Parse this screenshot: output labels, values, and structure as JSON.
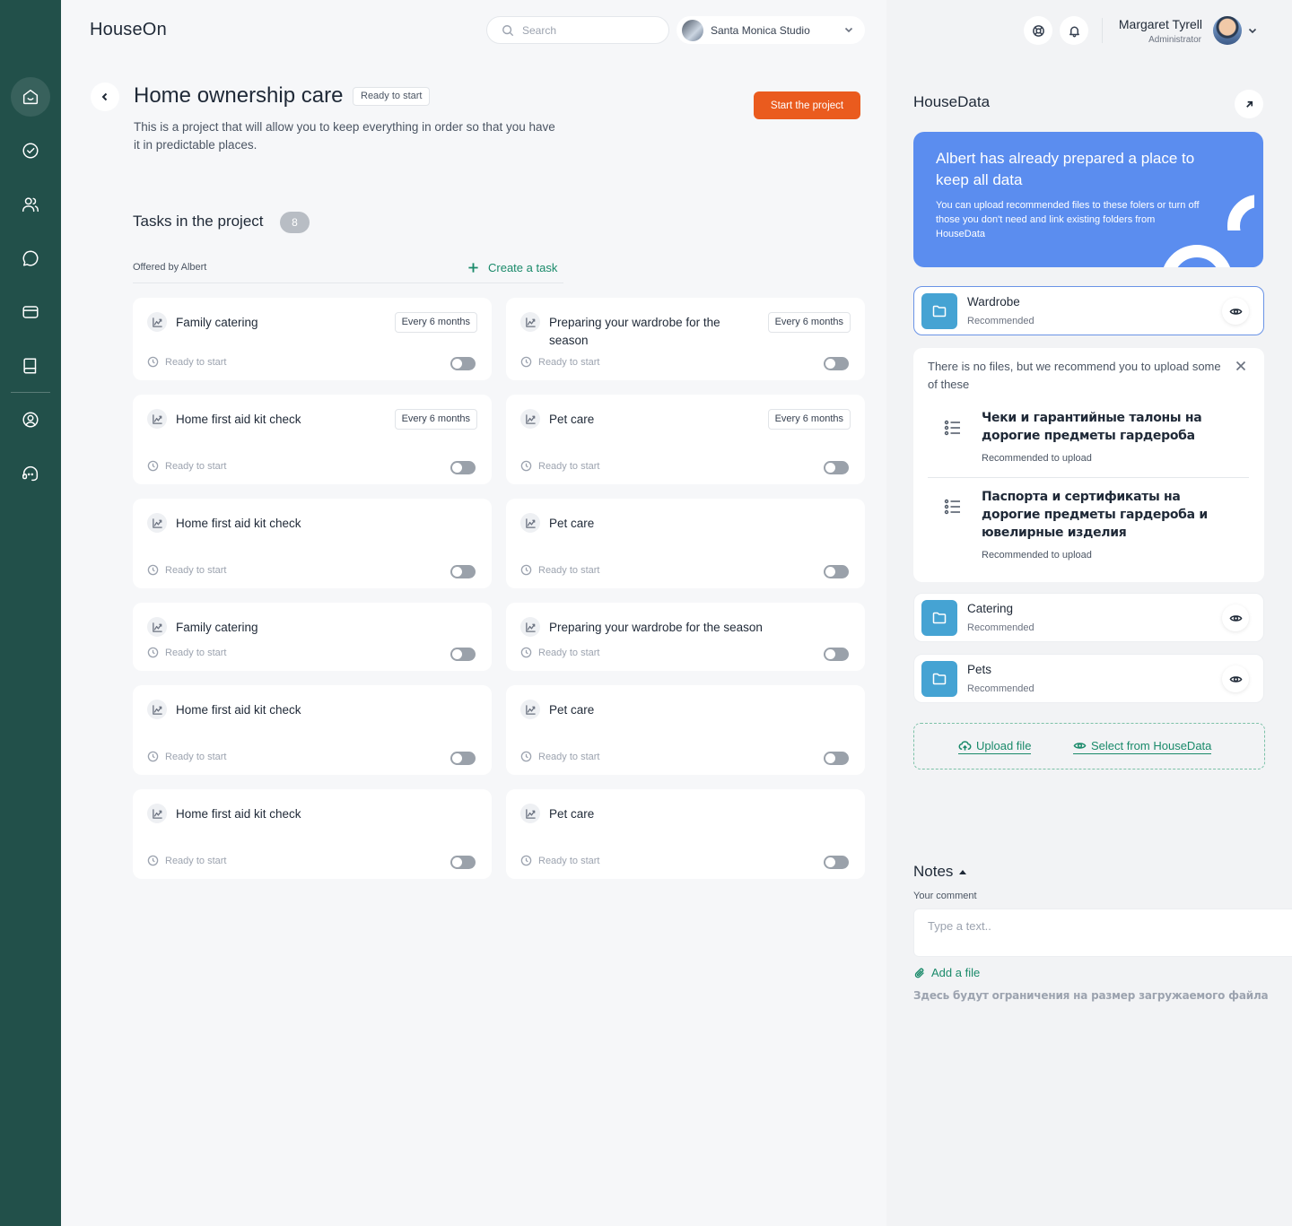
{
  "app": {
    "brand": "HouseOn"
  },
  "header": {
    "search_placeholder": "Search",
    "workspace": "Santa Monica Studio",
    "user": {
      "name": "Margaret Tyrell",
      "role": "Administrator"
    }
  },
  "sidebar": {
    "items": [
      {
        "icon": "home-icon",
        "active": true
      },
      {
        "icon": "check-circle-icon"
      },
      {
        "icon": "users-icon"
      },
      {
        "icon": "chat-icon"
      },
      {
        "icon": "card-icon"
      },
      {
        "icon": "book-icon"
      },
      {
        "icon": "profile-icon"
      },
      {
        "icon": "support-icon"
      }
    ]
  },
  "project": {
    "title": "Home ownership care",
    "status": "Ready to start",
    "description": "This is a project that will allow you to keep everything in order so that you have it in predictable places.",
    "start_label": "Start the project"
  },
  "tasks": {
    "title": "Tasks in the project",
    "count": "8",
    "offered_by": "Offered by Albert",
    "create_label": "Create a task",
    "items": [
      {
        "name": "Family catering",
        "frequency": "Every 6 months",
        "status": "Ready to start"
      },
      {
        "name": "Preparing your wardrobe for the season",
        "frequency": "Every 6 months",
        "status": "Ready to start"
      },
      {
        "name": "Home first aid kit check",
        "frequency": "Every 6 months",
        "status": "Ready to start"
      },
      {
        "name": "Pet care",
        "frequency": "Every 6 months",
        "status": "Ready to start"
      },
      {
        "name": "Home first aid kit check",
        "status": "Ready to start"
      },
      {
        "name": "Pet care",
        "status": "Ready to start"
      },
      {
        "name": "Family catering",
        "status": "Ready to start"
      },
      {
        "name": "Preparing your wardrobe for the season",
        "status": "Ready to start"
      },
      {
        "name": "Home first aid kit check",
        "status": "Ready to start"
      },
      {
        "name": "Pet care",
        "status": "Ready to start"
      },
      {
        "name": "Home first aid kit check",
        "status": "Ready to start"
      },
      {
        "name": "Pet care",
        "status": "Ready to start"
      }
    ]
  },
  "housedata": {
    "title": "HouseData",
    "promo_title": "Albert has already prepared a place to keep all data",
    "promo_text": "You can upload recommended files to these folers or turn off those you don't need and link existing folders from HouseData",
    "folders": [
      {
        "name": "Wardrobe",
        "sub": "Recommended"
      },
      {
        "name": "Catering",
        "sub": "Recommended"
      },
      {
        "name": "Pets",
        "sub": "Recommended"
      }
    ],
    "recommend_text": "There is no files, but we recommend you to upload some of these",
    "recommendations": [
      {
        "title": "Чеки и гарантийные талоны на дорогие предметы гардероба",
        "sub": "Recommended to upload"
      },
      {
        "title": "Паспорта и сертификаты на дорогие предметы гардероба и ювелирные изделия",
        "sub": "Recommended to upload"
      }
    ],
    "upload_label": "Upload file",
    "select_label": "Select from HouseData"
  },
  "notes": {
    "title": "Notes",
    "comment_label": "Your comment",
    "placeholder": "Type a text..",
    "add_file": "Add a file",
    "limit_text": "Здесь будут ограничения на размер загружаемого файла"
  },
  "colors": {
    "sidebar": "#22504a",
    "accent": "#ea5b1e",
    "link": "#1a8a6a",
    "promo": "#5b8def",
    "folder": "#45a3d3"
  }
}
